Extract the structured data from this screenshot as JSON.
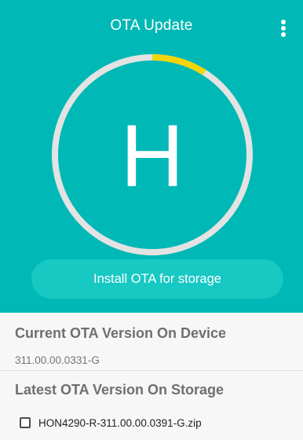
{
  "app": {
    "title": "OTA Update",
    "accent_color": "#00b8b5",
    "button_color": "#17c8c3",
    "ring_track_color": "#e3e3e3",
    "ring_progress_color": "#f2d50a"
  },
  "hero": {
    "logo_letter": "H",
    "progress_fraction": 0.09
  },
  "actions": {
    "install_label": "Install OTA for storage"
  },
  "current_version": {
    "title": "Current OTA Version On Device",
    "value": "311.00.00.0331-G"
  },
  "storage": {
    "title": "Latest OTA Version On Storage",
    "files": [
      {
        "name": "HON4290-R-311.00.00.0391-G.zip",
        "checked": false
      }
    ]
  },
  "icons": {
    "menu": "more-vertical-icon",
    "checkbox": "checkbox-unchecked-icon"
  }
}
